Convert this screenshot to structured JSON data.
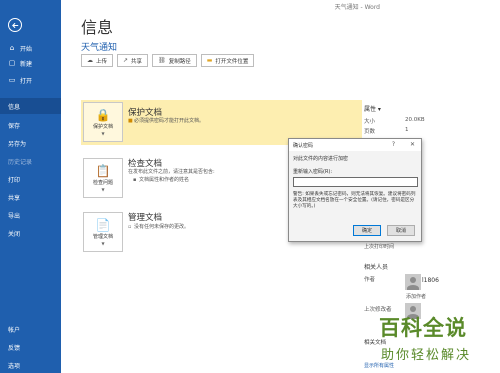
{
  "titlebar": {
    "text": "天气通知 - Word"
  },
  "sidebar": {
    "items": [
      {
        "label": "开始",
        "icon": "home-icon"
      },
      {
        "label": "新建",
        "icon": "new-icon"
      },
      {
        "label": "打开",
        "icon": "open-icon"
      },
      {
        "label": "信息"
      },
      {
        "label": "保存"
      },
      {
        "label": "另存为"
      },
      {
        "label": "历史记录"
      },
      {
        "label": "打印"
      },
      {
        "label": "共享"
      },
      {
        "label": "导出"
      },
      {
        "label": "关闭"
      },
      {
        "label": "帐户"
      },
      {
        "label": "反馈"
      },
      {
        "label": "选项"
      }
    ]
  },
  "page": {
    "title": "信息",
    "doc_title": "天气通知"
  },
  "actions": [
    {
      "label": "上传",
      "icon": "cloud-upload-icon"
    },
    {
      "label": "共享",
      "icon": "share-icon"
    },
    {
      "label": "复制路径",
      "icon": "link-icon"
    },
    {
      "label": "打开文件位置",
      "icon": "folder-icon"
    }
  ],
  "sections": {
    "protect": {
      "icon_label": "保护文档",
      "heading": "保护文档",
      "desc": "必须提供密码才能打开此文档。"
    },
    "inspect": {
      "icon_label": "检查问题",
      "heading": "检查文档",
      "desc": "在发布此文件之前，请注意其是否包含:",
      "bullet": "文档属性和作者的姓名"
    },
    "manage": {
      "icon_label": "管理文档",
      "heading": "管理文档",
      "desc": "没有任何未保存的更改。"
    }
  },
  "properties": {
    "title": "属性 ▾",
    "rows": [
      {
        "label": "大小",
        "value": "20.0KB"
      },
      {
        "label": "页数",
        "value": "1"
      }
    ],
    "last_printed": "上次打印时间",
    "people_title": "相关人员",
    "author_label": "作者",
    "author_name": "l1806",
    "add_author": "添加作者",
    "last_modified_by": "上次修改者",
    "related_docs": "相关文档",
    "show_all": "显示所有属性"
  },
  "dialog": {
    "title": "确认密码",
    "help": "?",
    "close": "✕",
    "prompt": "对此文件的内容进行加密",
    "label": "重新输入密码(R):",
    "input_value": "",
    "warning": "警告: 如果丢失或忘记密码，则无法将其恢复。建议将密码列表及其相应文档名放在一个安全位置。(请记住，密码是区分大小写的。)",
    "ok": "确定",
    "cancel": "取消"
  },
  "watermark": {
    "line1": "百科全说",
    "line2": "助你轻松解决"
  }
}
